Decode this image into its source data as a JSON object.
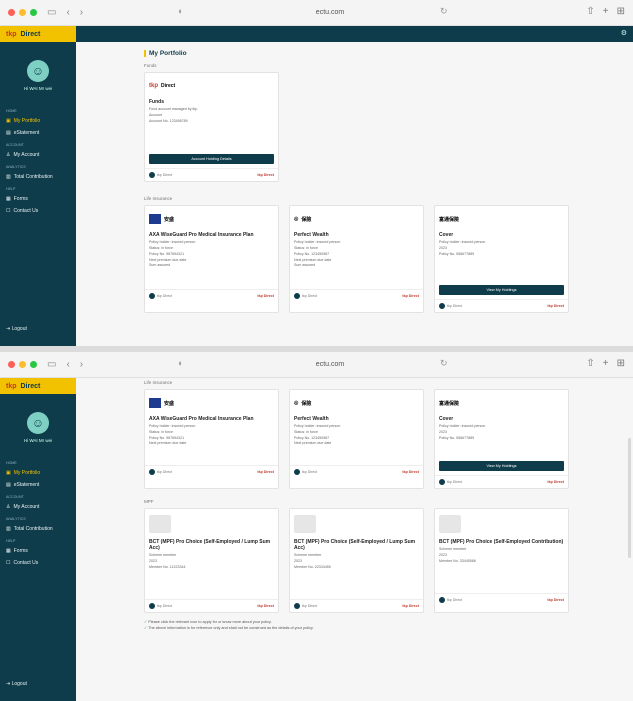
{
  "browser": {
    "url": "ectu.com"
  },
  "sidebar": {
    "brand": "tkp",
    "brand_suffix": "Direct",
    "user_name": "Hi WAI Mr wei",
    "sections": [
      {
        "title": "Home",
        "items": [
          {
            "label": "My Portfolio",
            "icon": "briefcase-icon",
            "active": true
          },
          {
            "label": "eStatement",
            "icon": "document-icon"
          }
        ]
      },
      {
        "title": "Account",
        "items": [
          {
            "label": "My Account",
            "icon": "user-icon"
          }
        ]
      },
      {
        "title": "Analytics",
        "items": [
          {
            "label": "Total Contribution",
            "icon": "chart-icon"
          }
        ]
      },
      {
        "title": "Help",
        "items": [
          {
            "label": "Forms",
            "icon": "form-icon"
          },
          {
            "label": "Contact Us",
            "icon": "phone-icon"
          }
        ]
      }
    ],
    "logout": "Logout"
  },
  "page": {
    "title": "My Portfolio",
    "section_funds": "Funds",
    "section_life": "Life Insurance",
    "section_mpf": "MPF",
    "footnote_1": "Please click the relevant icon to apply for or know more about your policy.",
    "footnote_2": "The above information is for reference only and shall not be construed as the details of your policy."
  },
  "cards_funds": [
    {
      "brand": "tkp",
      "brand_text": "Direct",
      "title": "Funds",
      "lines": [
        "Fund account managed by tkp",
        "Account",
        "Account No. 123456789"
      ],
      "button": "Account Holding Details",
      "foot_left": "tkp Direct",
      "foot_right": "tkp Direct"
    }
  ],
  "cards_life": [
    {
      "brand": "axa",
      "brand_text": "安盛",
      "title": "AXA WiseGuard Pro Medical Insurance Plan",
      "lines": [
        "Policy holder: insured person",
        "Status: in force",
        "Policy No. 987654321",
        "Next premium due date",
        "Sum assured"
      ],
      "foot_left": "tkp Direct",
      "foot_right": "tkp Direct"
    },
    {
      "brand": "green",
      "brand_text": "保險",
      "title": "Perfect Wealth",
      "lines": [
        "Policy holder: insured person",
        "Status: in force",
        "Policy No. 123450987",
        "Next premium due date",
        "Sum assured"
      ],
      "foot_left": "tkp Direct",
      "foot_right": "tkp Direct"
    },
    {
      "brand": "ftl",
      "brand_text": "富通保險",
      "title": "Cover",
      "lines": [
        "Policy holder: insured person",
        "2023",
        "Policy No. 556677889"
      ],
      "button": "View My Holdings",
      "foot_left": "tkp Direct",
      "foot_right": "tkp Direct"
    }
  ],
  "cards_mpf": [
    {
      "title": "BCT (MPF) Pro Choice (Self-Employed / Lump Sum Acc)",
      "lines": [
        "Scheme member",
        "2023",
        "Member No. 11223344"
      ],
      "foot_left": "tkp Direct",
      "foot_right": "tkp Direct"
    },
    {
      "title": "BCT (MPF) Pro Choice (Self-Employed / Lump Sum Acc)",
      "lines": [
        "Scheme member",
        "2023",
        "Member No. 22334455"
      ],
      "foot_left": "tkp Direct",
      "foot_right": "tkp Direct"
    },
    {
      "title": "BCT (MPF) Pro Choice (Self-Employed Contribution)",
      "lines": [
        "Scheme member",
        "2023",
        "Member No. 33445566"
      ],
      "foot_left": "tkp Direct",
      "foot_right": "tkp Direct"
    }
  ]
}
